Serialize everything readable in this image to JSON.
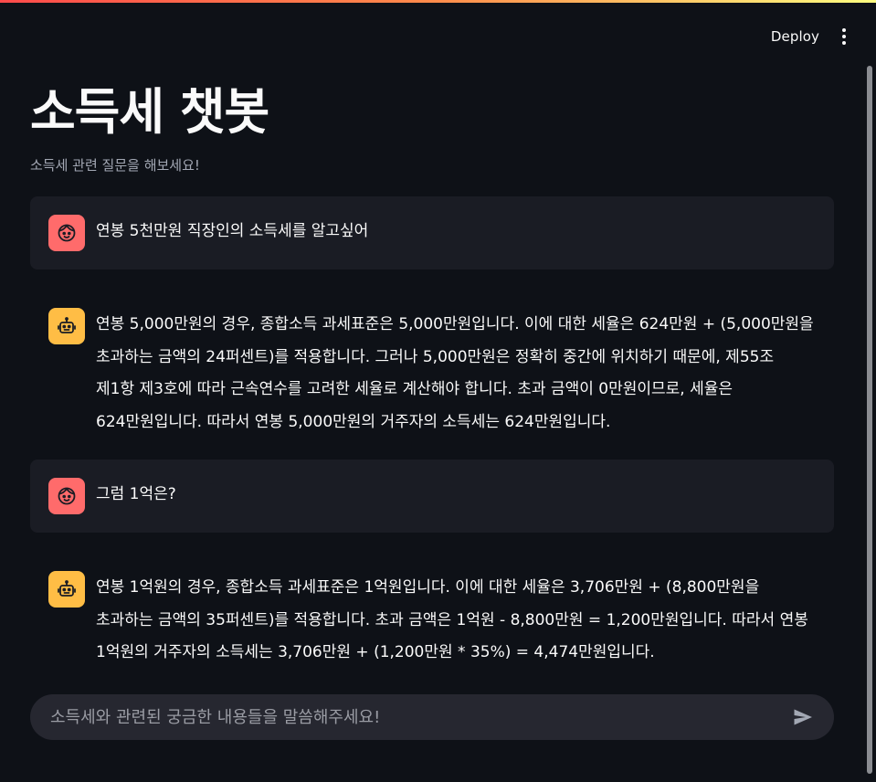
{
  "header": {
    "deploy_label": "Deploy",
    "menu_icon": "kebab-menu-icon"
  },
  "page": {
    "title": "소득세 챗봇",
    "caption": "소득세 관련 질문을 해보세요!"
  },
  "messages": [
    {
      "role": "user",
      "icon": "user-face-icon",
      "text": "연봉 5천만원 직장인의 소득세를 알고싶어"
    },
    {
      "role": "assistant",
      "icon": "robot-icon",
      "text": "연봉 5,000만원의 경우, 종합소득 과세표준은 5,000만원입니다. 이에 대한 세율은 624만원 + (5,000만원을 초과하는 금액의 24퍼센트)를 적용합니다. 그러나 5,000만원은 정확히 중간에 위치하기 때문에, 제55조 제1항 제3호에 따라 근속연수를 고려한 세율로 계산해야 합니다. 초과 금액이 0만원이므로, 세율은 624만원입니다. 따라서 연봉 5,000만원의 거주자의 소득세는 624만원입니다."
    },
    {
      "role": "user",
      "icon": "user-face-icon",
      "text": "그럼 1억은?"
    },
    {
      "role": "assistant",
      "icon": "robot-icon",
      "text": "연봉 1억원의 경우, 종합소득 과세표준은 1억원입니다. 이에 대한 세율은 3,706만원 + (8,800만원을 초과하는 금액의 35퍼센트)를 적용합니다. 초과 금액은 1억원 - 8,800만원 = 1,200만원입니다. 따라서 연봉 1억원의 거주자의 소득세는 3,706만원 + (1,200만원 * 35%) = 4,474만원입니다."
    }
  ],
  "chat_input": {
    "value": "",
    "placeholder": "소득세와 관련된 궁금한 내용들을 말씀해주세요!",
    "send_icon": "send-arrow-icon"
  },
  "colors": {
    "background": "#0e1117",
    "user_bubble": "#1a1c24",
    "user_avatar": "#ff6b6b",
    "bot_avatar": "#ffbd45",
    "input_bg": "#262730"
  }
}
